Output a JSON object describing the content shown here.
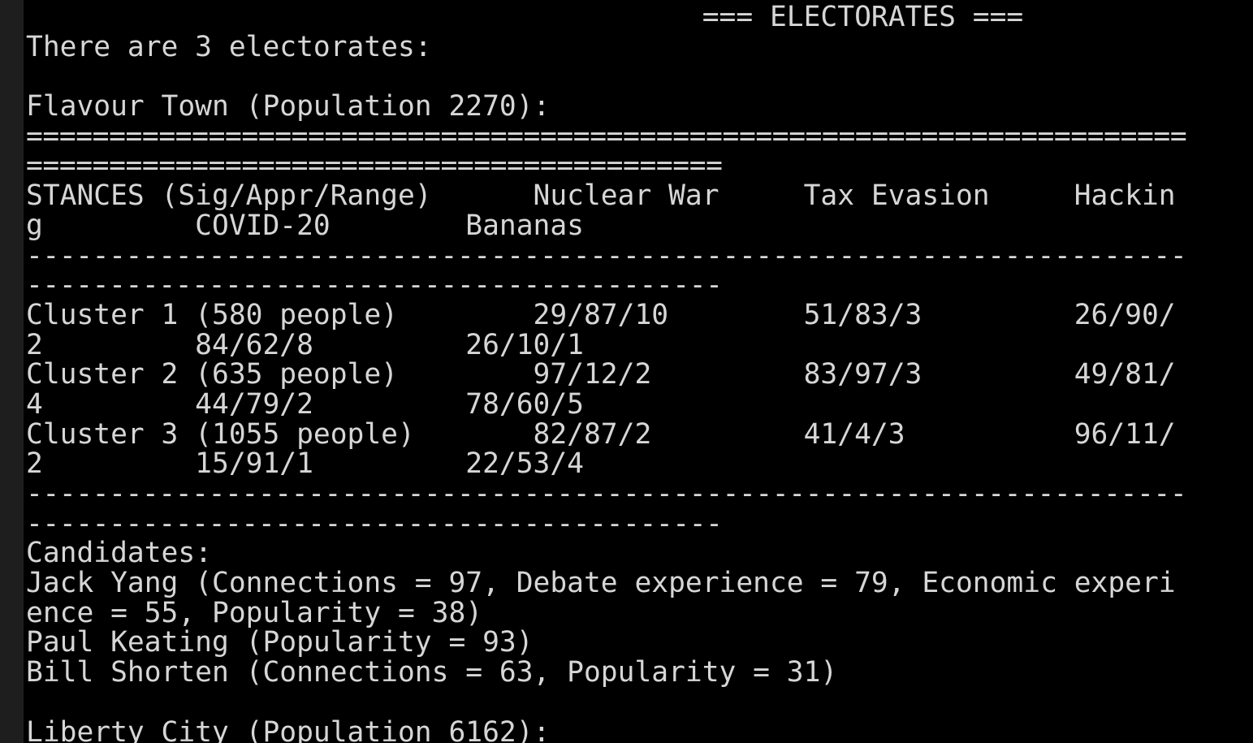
{
  "console": {
    "lines": [
      {
        "text": "                                        === ELECTORATES ===",
        "kind": "header"
      },
      {
        "text": "There are 3 electorates:",
        "kind": "text"
      },
      {
        "text": "",
        "kind": "blank"
      },
      {
        "text": "Flavour Town (Population 2270):",
        "kind": "heading"
      },
      {
        "text": "======================================================================",
        "kind": "separator"
      },
      {
        "text": "==========================================",
        "kind": "separator"
      },
      {
        "text": "STANCES (Sig/Appr/Range)      Nuclear War     Tax Evasion     Hackin",
        "kind": "table-header"
      },
      {
        "text": "g         COVID-20        Bananas",
        "kind": "table-header"
      },
      {
        "text": "----------------------------------------------------------------------",
        "kind": "separator"
      },
      {
        "text": "------------------------------------------",
        "kind": "separator"
      },
      {
        "text": "Cluster 1 (580 people)        29/87/10        51/83/3         26/90/",
        "kind": "table-row"
      },
      {
        "text": "2         84/62/8         26/10/1",
        "kind": "table-row"
      },
      {
        "text": "Cluster 2 (635 people)        97/12/2         83/97/3         49/81/",
        "kind": "table-row"
      },
      {
        "text": "4         44/79/2         78/60/5",
        "kind": "table-row"
      },
      {
        "text": "Cluster 3 (1055 people)       82/87/2         41/4/3          96/11/",
        "kind": "table-row"
      },
      {
        "text": "2         15/91/1         22/53/4",
        "kind": "table-row"
      },
      {
        "text": "----------------------------------------------------------------------",
        "kind": "separator"
      },
      {
        "text": "------------------------------------------",
        "kind": "separator"
      },
      {
        "text": "Candidates:",
        "kind": "heading"
      },
      {
        "text": "Jack Yang (Connections = 97, Debate experience = 79, Economic experi",
        "kind": "candidate"
      },
      {
        "text": "ence = 55, Popularity = 38)",
        "kind": "candidate"
      },
      {
        "text": "Paul Keating (Popularity = 93)",
        "kind": "candidate"
      },
      {
        "text": "Bill Shorten (Connections = 63, Popularity = 31)",
        "kind": "candidate"
      },
      {
        "text": "",
        "kind": "blank"
      },
      {
        "text": "Liberty City (Population 6162):",
        "kind": "heading"
      }
    ]
  },
  "colors": {
    "background": "#000000",
    "foreground": "#d6d6d6",
    "gutter": "#1e1e1e"
  }
}
